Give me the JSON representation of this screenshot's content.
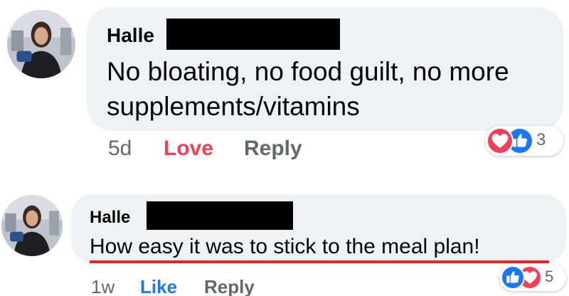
{
  "comments": [
    {
      "author": "Halle",
      "text": "No bloating, no food guilt, no more supplements/vitamins",
      "time": "5d",
      "reaction_action": "Love",
      "reaction_action_color": "#f33e58",
      "reply_label": "Reply",
      "reactions": {
        "icons": [
          "love-icon",
          "like-icon"
        ],
        "count": "3"
      }
    },
    {
      "author": "Halle",
      "text": "How easy it was to stick to the meal plan!",
      "time": "1w",
      "reaction_action": "Like",
      "reaction_action_color": "#1877f2",
      "reply_label": "Reply",
      "reactions": {
        "icons": [
          "like-icon",
          "love-icon"
        ],
        "count": "5"
      }
    }
  ],
  "colors": {
    "bubble": "#eff1f4",
    "love": "#f33e58",
    "like": "#1877f2",
    "meta": "#65676b",
    "annotation_underline": "#e5252a"
  }
}
